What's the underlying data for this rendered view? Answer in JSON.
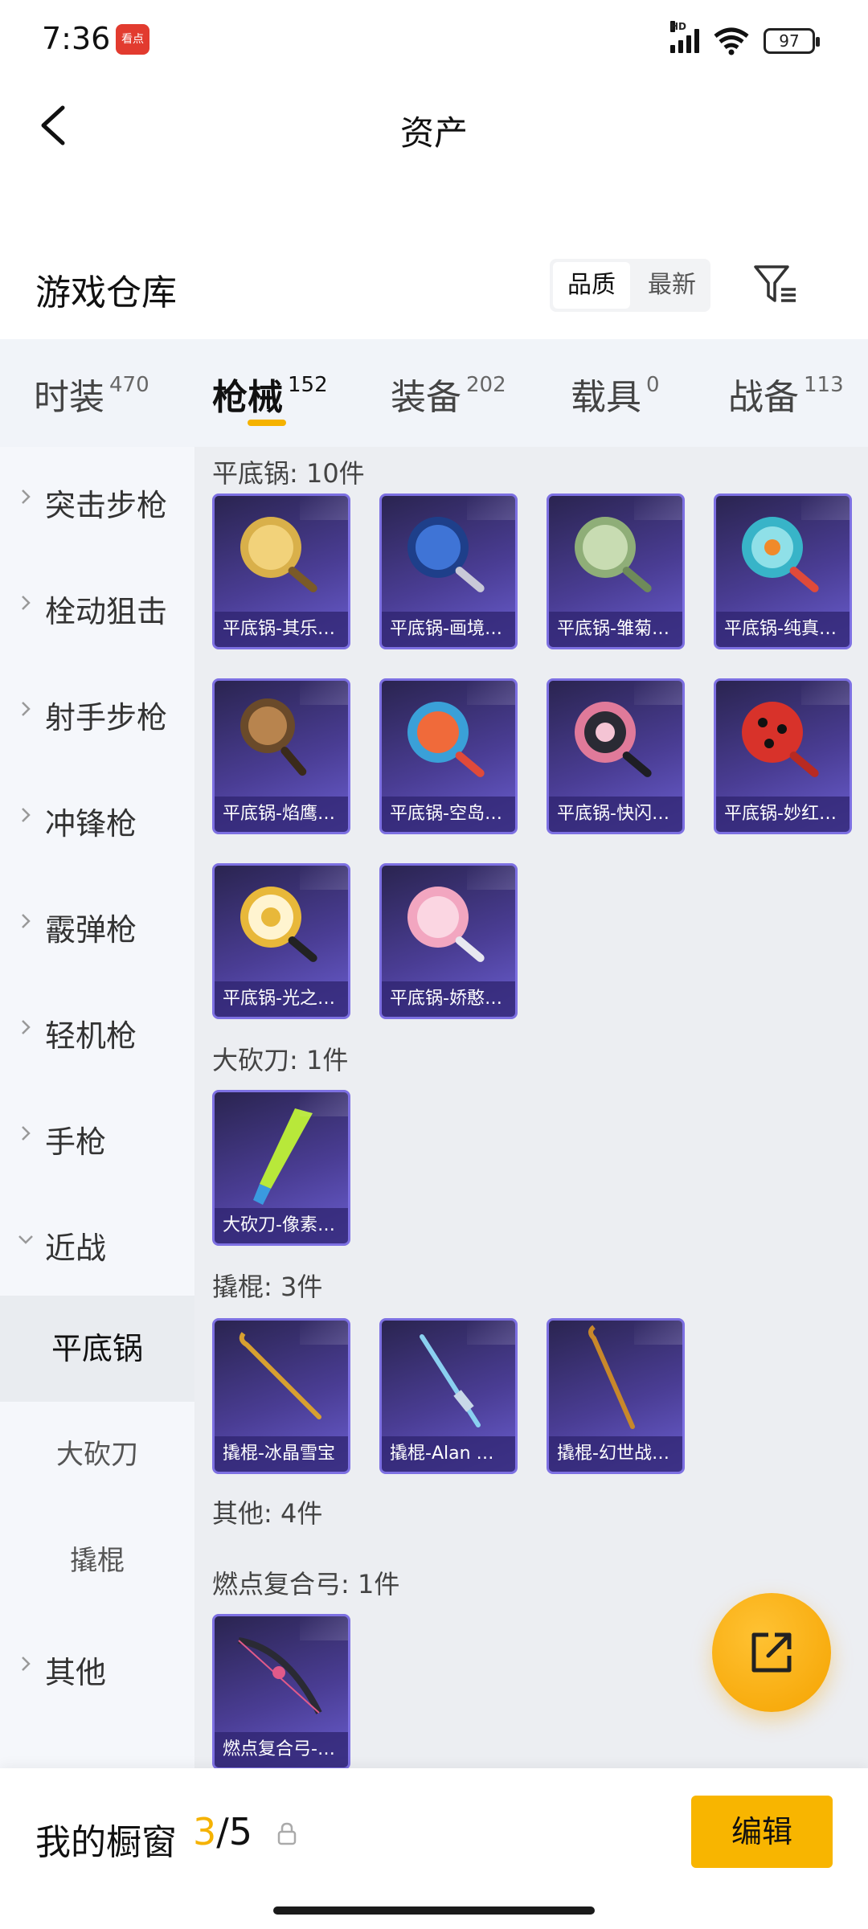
{
  "status_bar": {
    "time": "7:36",
    "app_badge": "看点",
    "network": "HD",
    "battery": "97"
  },
  "header": {
    "title": "资产"
  },
  "warehouse": {
    "title": "游戏仓库",
    "sort_options": [
      "品质",
      "最新"
    ],
    "active_sort": "品质"
  },
  "tabs": [
    {
      "label": "时装",
      "count": "470"
    },
    {
      "label": "枪械",
      "count": "152",
      "active": true
    },
    {
      "label": "装备",
      "count": "202"
    },
    {
      "label": "载具",
      "count": "0"
    },
    {
      "label": "战备",
      "count": "113"
    }
  ],
  "sidebar": {
    "categories": [
      "突击步枪",
      "栓动狙击",
      "射手步枪",
      "冲锋枪",
      "霰弹枪",
      "轻机枪",
      "手枪",
      "近战"
    ],
    "expanded": "近战",
    "subcategories": [
      "平底锅",
      "大砍刀",
      "撬棍"
    ],
    "active_sub": "平底锅",
    "other": "其他"
  },
  "groups": [
    {
      "title": "平底锅: 10件",
      "items": [
        "平底锅-其乐…",
        "平底锅-画境…",
        "平底锅-雏菊…",
        "平底锅-纯真…",
        "平底锅-焰鹰…",
        "平底锅-空岛…",
        "平底锅-快闪…",
        "平底锅-妙红…",
        "平底锅-光之…",
        "平底锅-娇憨…"
      ]
    },
    {
      "title": "大砍刀: 1件",
      "items": [
        "大砍刀-像素…"
      ]
    },
    {
      "title": "撬棍: 3件",
      "items": [
        "撬棍-冰晶雪宝",
        "撬棍-Alan W…",
        "撬棍-幻世战…"
      ]
    },
    {
      "title": "其他: 4件",
      "items": []
    },
    {
      "title": "燃点复合弓: 1件",
      "items": [
        "燃点复合弓-…"
      ]
    }
  ],
  "bottom": {
    "showcase_label": "我的橱窗",
    "showcase_current": "3",
    "showcase_total": "/5",
    "edit_label": "编辑"
  },
  "colors": {
    "accent": "#f5b200",
    "card_purple": "#4a3d94"
  },
  "icons": {
    "back": "chevron-left-icon",
    "filter": "filter-icon",
    "share": "share-icon",
    "lock": "lock-icon"
  }
}
